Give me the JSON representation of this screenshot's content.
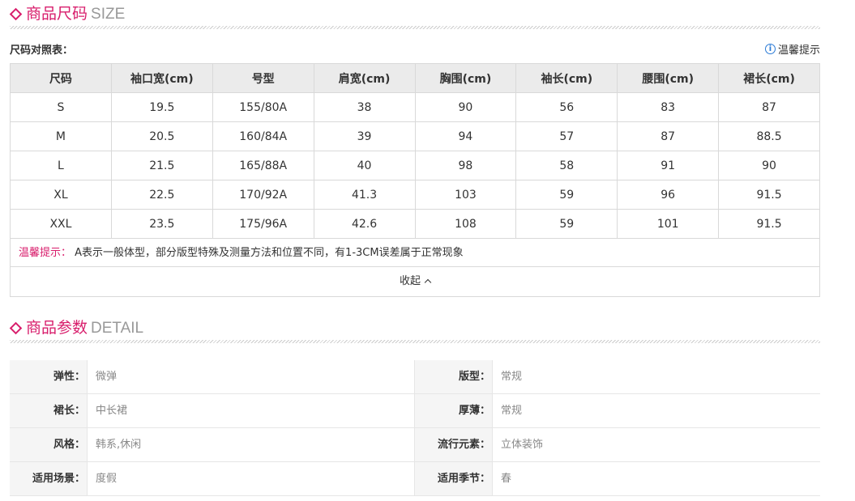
{
  "size_section": {
    "title_cn": "商品尺码",
    "title_en": "SIZE"
  },
  "chart_title": "尺码对照表：",
  "tip_link": "温馨提示",
  "table": {
    "headers": [
      "尺码",
      "袖口宽(cm)",
      "号型",
      "肩宽(cm)",
      "胸围(cm)",
      "袖长(cm)",
      "腰围(cm)",
      "裙长(cm)"
    ],
    "rows": [
      [
        "S",
        "19.5",
        "155/80A",
        "38",
        "90",
        "56",
        "83",
        "87"
      ],
      [
        "M",
        "20.5",
        "160/84A",
        "39",
        "94",
        "57",
        "87",
        "88.5"
      ],
      [
        "L",
        "21.5",
        "165/88A",
        "40",
        "98",
        "58",
        "91",
        "90"
      ],
      [
        "XL",
        "22.5",
        "170/92A",
        "41.3",
        "103",
        "59",
        "96",
        "91.5"
      ],
      [
        "XXL",
        "23.5",
        "175/96A",
        "42.6",
        "108",
        "59",
        "101",
        "91.5"
      ]
    ]
  },
  "note": {
    "label": "温馨提示：",
    "text": "A表示一般体型，部分版型特殊及测量方法和位置不同，有1-3CM误差属于正常现象"
  },
  "collapse_label": "收起",
  "detail_section": {
    "title_cn": "商品参数",
    "title_en": "DETAIL"
  },
  "params": [
    [
      {
        "k": "弹性：",
        "v": "微弹"
      },
      {
        "k": "版型：",
        "v": "常规"
      }
    ],
    [
      {
        "k": "裙长：",
        "v": "中长裙"
      },
      {
        "k": "厚薄：",
        "v": "常规"
      }
    ],
    [
      {
        "k": "风格：",
        "v": "韩系,休闲"
      },
      {
        "k": "流行元素：",
        "v": "立体装饰"
      }
    ],
    [
      {
        "k": "适用场景：",
        "v": "度假"
      },
      {
        "k": "适用季节：",
        "v": "春"
      }
    ]
  ],
  "colors": {
    "accent": "#d81e6c",
    "header_bg": "#ebebeb",
    "info_blue": "#2a7ad6"
  }
}
